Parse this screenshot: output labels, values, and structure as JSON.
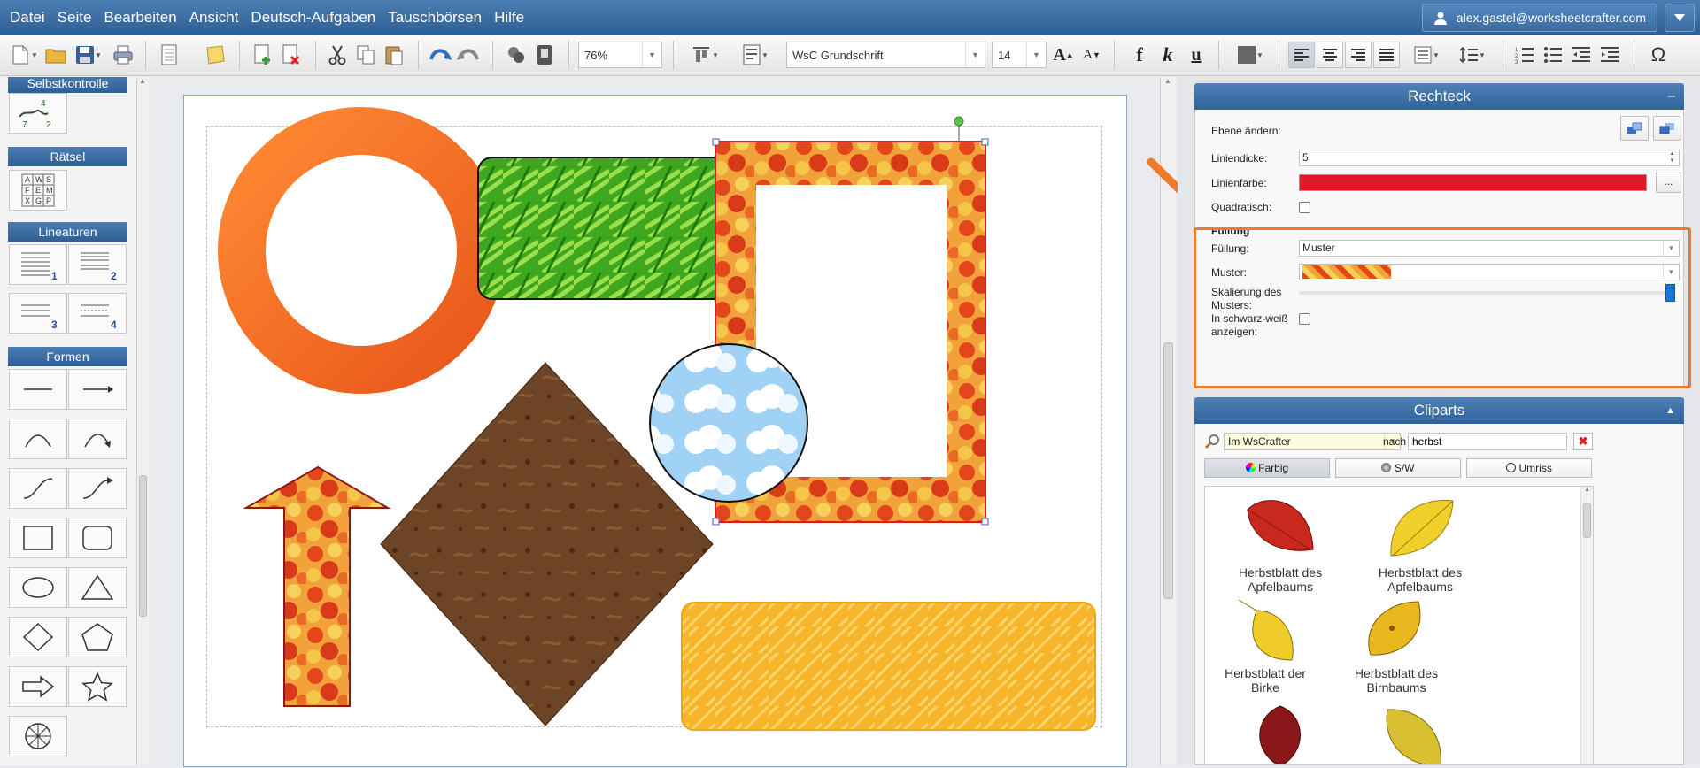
{
  "menu": [
    "Datei",
    "Seite",
    "Bearbeiten",
    "Ansicht",
    "Deutsch-Aufgaben",
    "Tauschbörsen",
    "Hilfe"
  ],
  "user": {
    "email": "alex.gastel@worksheetcrafter.com"
  },
  "toolbar": {
    "zoom": "76%",
    "font": "WsC Grundschrift",
    "font_size": "14",
    "bold": "f",
    "italic": "k",
    "underline": "u",
    "grow_font": "A",
    "shrink_font": "A",
    "special_char": "Ω"
  },
  "left_panel": {
    "categories": [
      "Selbstkontrolle",
      "Rätsel",
      "Lineaturen",
      "Formen"
    ],
    "selbstkontrolle_digits": [
      "4",
      "7",
      "2"
    ],
    "raetsel_letters": [
      "A",
      "W",
      "S",
      "F",
      "E",
      "M",
      "X",
      "G",
      "P"
    ],
    "lineatur_numbers": [
      "1",
      "2",
      "3",
      "4"
    ]
  },
  "rectangle_panel": {
    "title": "Rechteck",
    "collapse": "–",
    "ebene_label": "Ebene ändern:",
    "liniendicke_label": "Liniendicke:",
    "liniendicke_value": "5",
    "linienfarbe_label": "Linienfarbe:",
    "linienfarbe_color": "#e01a22",
    "more_button": "...",
    "quadratisch_label": "Quadratisch:",
    "fuellung_section": "Füllung",
    "fuellung_label": "Füllung:",
    "fuellung_value": "Muster",
    "muster_label": "Muster:",
    "skalierung_label": "Skalierung des Musters:",
    "skalierung_value": 1.0,
    "sw_label": "In schwarz-weiß anzeigen:"
  },
  "cliparts_panel": {
    "title": "Cliparts",
    "source": "Im WsCrafter",
    "nach": "nach",
    "query": "herbst",
    "tabs": [
      "Farbig",
      "S/W",
      "Umriss"
    ],
    "items": [
      "Herbstblatt des Apfelbaums",
      "Herbstblatt des Apfelbaums",
      "Herbstblatt der Birke",
      "Herbstblatt des Birnbaums"
    ]
  },
  "colors": {
    "accent": "#2f6298",
    "highlight": "#ee7b29"
  }
}
